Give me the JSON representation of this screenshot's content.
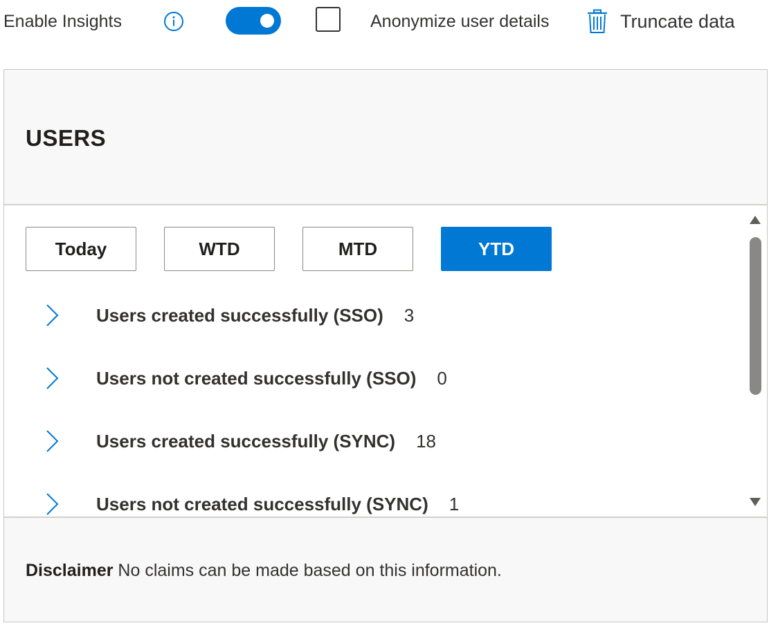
{
  "toolbar": {
    "enable_insights_label": "Enable Insights",
    "info_icon": "info-icon",
    "toggle_state": "on",
    "anonymize_checked": false,
    "anonymize_label": "Anonymize user details",
    "truncate_icon": "trash-icon",
    "truncate_label": "Truncate data"
  },
  "panel": {
    "title": "USERS",
    "tabs": [
      {
        "label": "Today",
        "active": false
      },
      {
        "label": "WTD",
        "active": false
      },
      {
        "label": "MTD",
        "active": false
      },
      {
        "label": "YTD",
        "active": true
      }
    ],
    "items": [
      {
        "label": "Users created successfully (SSO)",
        "count": "3"
      },
      {
        "label": "Users not created successfully (SSO)",
        "count": "0"
      },
      {
        "label": "Users created successfully (SYNC)",
        "count": "18"
      },
      {
        "label": "Users not created successfully (SYNC)",
        "count": "1"
      }
    ],
    "disclaimer_title": "Disclaimer",
    "disclaimer_text": "No claims can be made based on this information."
  },
  "colors": {
    "accent": "#0078d4",
    "text": "#323130",
    "header_bg": "#f8f8f8",
    "scroll_thumb": "#8a8886"
  }
}
